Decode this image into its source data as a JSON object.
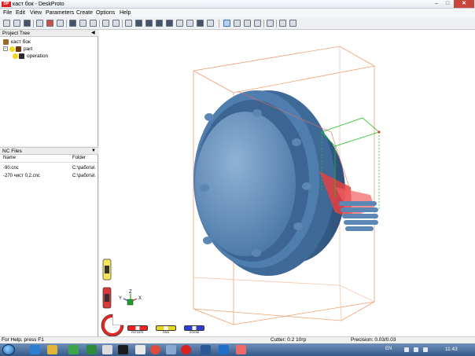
{
  "window": {
    "logo_text": "DP",
    "title": "каст бок - DeskProto",
    "min_glyph": "–",
    "max_glyph": "□",
    "close_glyph": "✕"
  },
  "menu": [
    "File",
    "Edit",
    "View",
    "Parameters",
    "Create",
    "Options",
    "Help"
  ],
  "toolbar": {
    "icons": [
      "new-file-icon",
      "open-folder-icon",
      "save-icon",
      "import-icon",
      "cut-icon",
      "export-icon",
      "print-icon",
      "print-preview-icon",
      "preferences-icon",
      "grid-icon",
      "layers-icon",
      "visibility-icon",
      "view-front-icon",
      "view-back-icon",
      "view-left-icon",
      "view-right-icon",
      "view-top-icon",
      "view-bottom-icon",
      "view-iso-icon",
      "view-iso2-icon",
      "rotate-icon",
      "select-icon",
      "pan-icon",
      "zoom-icon",
      "zoom-fit-icon",
      "info-icon",
      "help-icon",
      "whats-this-icon"
    ]
  },
  "project_tree": {
    "title": "Project Tree",
    "pin_glyph": "◀",
    "items": [
      {
        "label": "каст бок",
        "level": 0
      },
      {
        "label": "part",
        "level": 1
      },
      {
        "label": "operation",
        "level": 2
      }
    ]
  },
  "nc_files": {
    "title": "NC Files",
    "dropdown_glyph": "▼",
    "columns": [
      "Name",
      "Folder"
    ],
    "rows": [
      {
        "name": "-90.cnc",
        "folder": "C:\\работа\\"
      },
      {
        "name": "-270 чист 0,2.cnc",
        "folder": "C:\\работа\\"
      }
    ]
  },
  "viewport": {
    "axis_labels": {
      "x": "X",
      "y": "Y",
      "z": "Z"
    },
    "mouse_controls": [
      "ROTATE",
      "PAN",
      "ZOOM"
    ],
    "colors": {
      "part": "#5b87b5",
      "bounding_box": "#f0a070",
      "toolpath": "#e84040",
      "cutter_box": "#22c022"
    }
  },
  "status": {
    "help": "For Help, press F1",
    "cutter": "Cutter: 0.2 10гр",
    "precision": "Precision: 0.03/0.03"
  },
  "taskbar": {
    "apps": [
      "ie-icon",
      "explorer-icon",
      "media-player-icon",
      "excel-icon",
      "chrome-icon",
      "firefox-icon",
      "settings-icon",
      "photoshop-icon",
      "editor-icon",
      "chrome2-icon",
      "opera-icon",
      "word-icon",
      "calc-icon",
      "deskproto-icon"
    ],
    "language": "EN",
    "time": "11:43"
  }
}
